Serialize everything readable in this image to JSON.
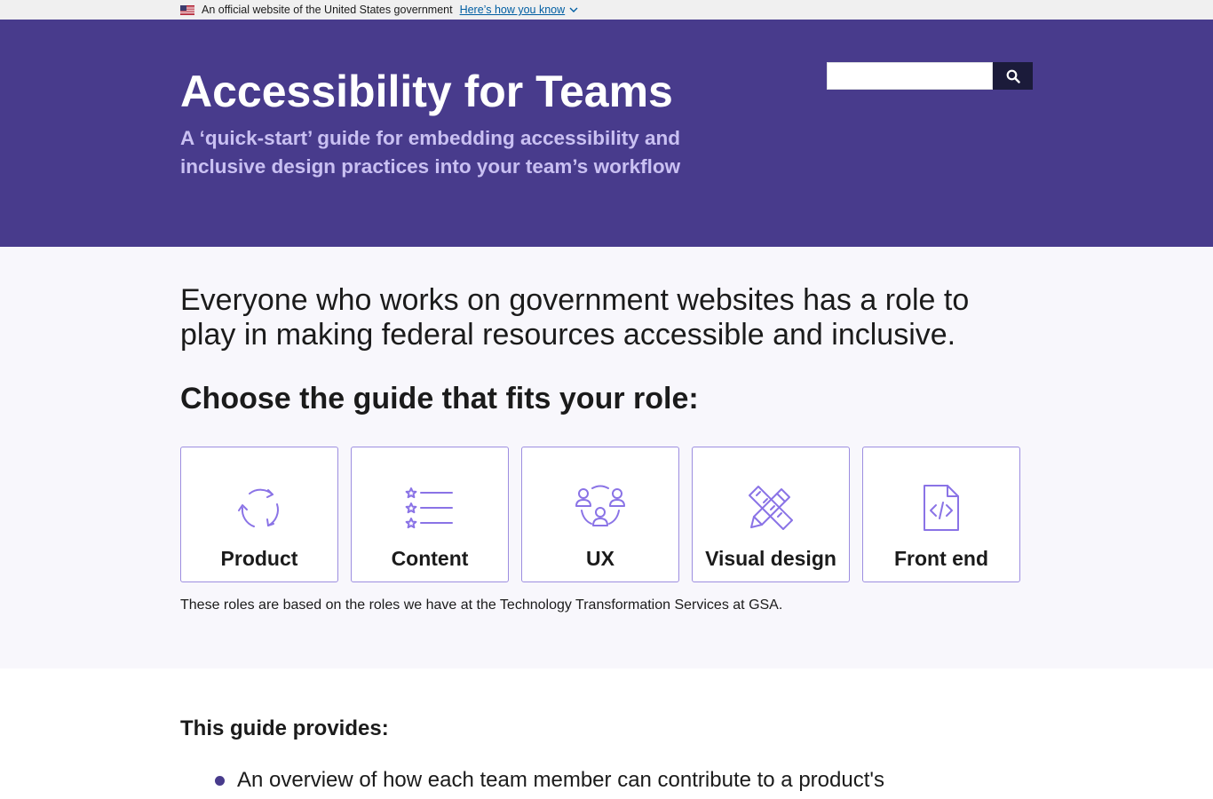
{
  "banner": {
    "official_text": "An official website of the United States government",
    "link_label": "Here’s how you know"
  },
  "hero": {
    "title": "Accessibility for Teams",
    "tagline": "A ‘quick-start’ guide for embedding accessibility and inclusive design practices into your team’s workflow",
    "search_placeholder": "",
    "search_icon": "search-icon"
  },
  "roles": {
    "lede": "Everyone who works on government websites has a role to play in making federal resources accessible and inclusive.",
    "heading": "Choose the guide that fits your role:",
    "cards": [
      {
        "label": "Product",
        "icon": "cycle-arrows-icon"
      },
      {
        "label": "Content",
        "icon": "star-list-icon"
      },
      {
        "label": "UX",
        "icon": "users-icon"
      },
      {
        "label": "Visual design",
        "icon": "pencil-ruler-icon"
      },
      {
        "label": "Front end",
        "icon": "code-file-icon"
      }
    ],
    "note": "These roles are based on the roles we have at the Technology Transformation Services at GSA."
  },
  "provides": {
    "heading": "This guide provides:",
    "items": [
      "An overview of how each team member can contribute to a product's"
    ]
  },
  "colors": {
    "hero_bg": "#483b8c",
    "tagline": "#c9c0f2",
    "card_border": "#9d8ee0",
    "icon": "#8a73e6",
    "link": "#005ea2"
  }
}
